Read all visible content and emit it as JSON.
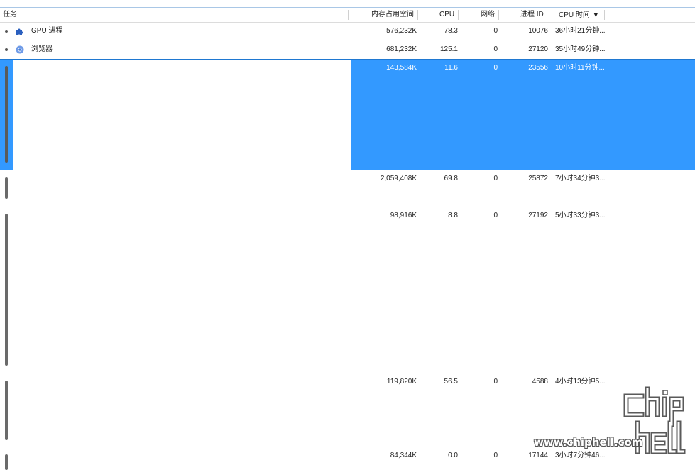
{
  "header": {
    "task": "任务",
    "memory": "内存占用空间",
    "cpu": "CPU",
    "network": "网络",
    "pid": "进程 ID",
    "cpu_time": "CPU 时间",
    "sort_arrow": "▼"
  },
  "rows": [
    {
      "name": "GPU 进程",
      "icon": "puzzle-icon",
      "memory": "576,232K",
      "cpu": "78.3",
      "network": "0",
      "pid": "10076",
      "cpu_time": "36小时21分钟..."
    },
    {
      "name": "浏览器",
      "icon": "browser-icon",
      "memory": "681,232K",
      "cpu": "125.1",
      "network": "0",
      "pid": "27120",
      "cpu_time": "35小时49分钟..."
    },
    {
      "name": "",
      "memory": "143,584K",
      "cpu": "11.6",
      "network": "0",
      "pid": "23556",
      "cpu_time": "10小时11分钟...",
      "selected": true
    },
    {
      "name": "",
      "memory": "2,059,408K",
      "cpu": "69.8",
      "network": "0",
      "pid": "25872",
      "cpu_time": "7小时34分钟3..."
    },
    {
      "name": "",
      "memory": "98,916K",
      "cpu": "8.8",
      "network": "0",
      "pid": "27192",
      "cpu_time": "5小时33分钟3..."
    },
    {
      "name": "",
      "memory": "119,820K",
      "cpu": "56.5",
      "network": "0",
      "pid": "4588",
      "cpu_time": "4小时13分钟5..."
    },
    {
      "name": "",
      "memory": "84,344K",
      "cpu": "0.0",
      "network": "0",
      "pid": "17144",
      "cpu_time": "3小时7分钟46..."
    }
  ],
  "watermark": {
    "url": "www.chiphell.com"
  },
  "colors": {
    "selection": "#3399ff",
    "accent_border": "#a9c7e6"
  }
}
